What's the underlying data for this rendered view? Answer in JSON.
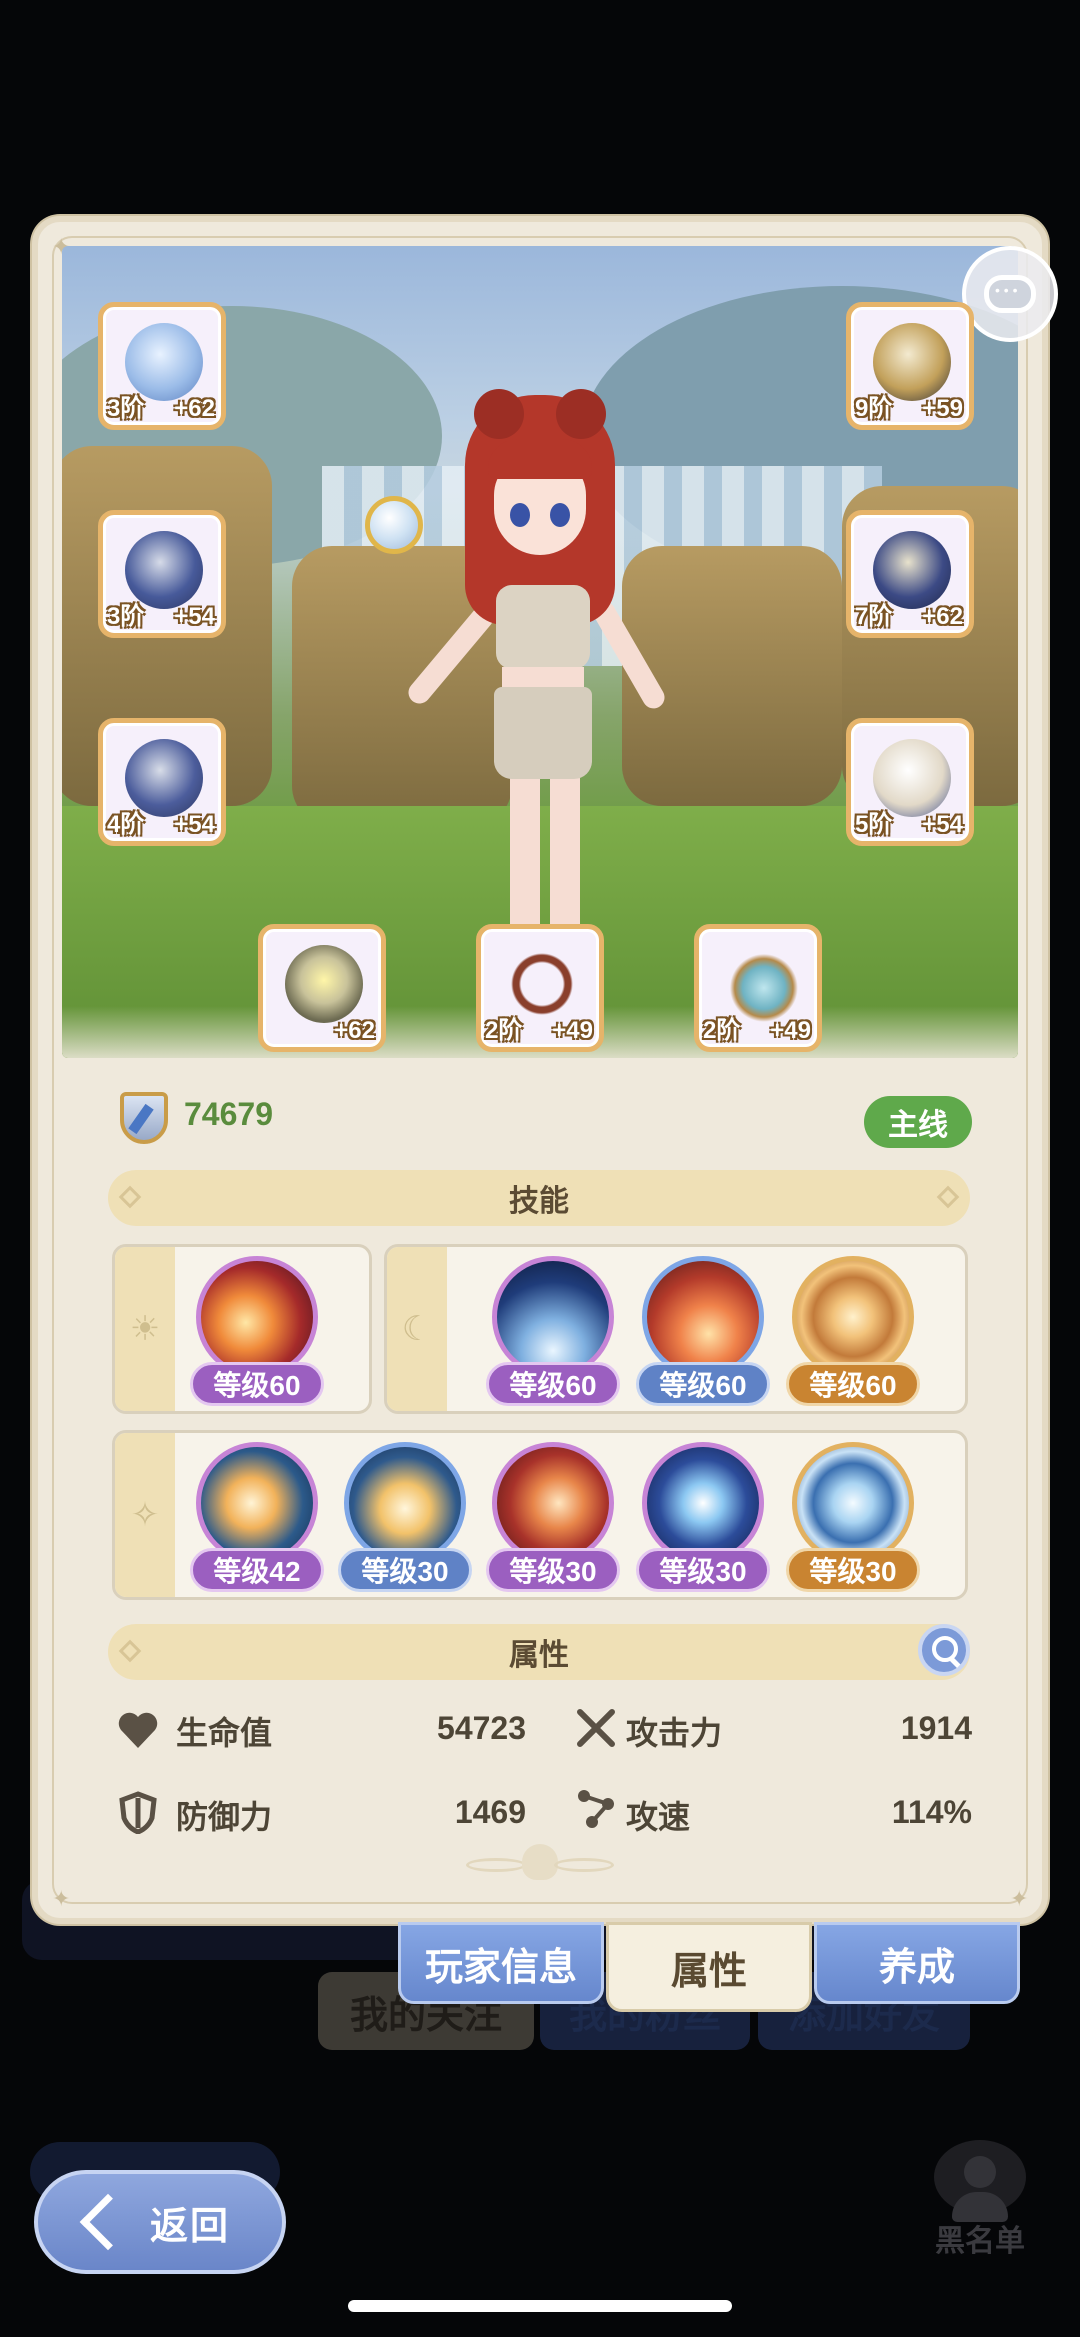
{
  "dialog": {
    "power_value": "74679",
    "main_badge": "主线",
    "skills_title": "技能",
    "attributes_title": "属性"
  },
  "equipment": [
    {
      "slot": "left-1",
      "tier": "3阶",
      "bonus": "+62",
      "icon": "crystal-weapon-icon"
    },
    {
      "slot": "left-2",
      "tier": "3阶",
      "bonus": "+54",
      "icon": "armor-chest-icon"
    },
    {
      "slot": "left-3",
      "tier": "4阶",
      "bonus": "+54",
      "icon": "leg-armor-icon"
    },
    {
      "slot": "right-1",
      "tier": "9阶",
      "bonus": "+59",
      "icon": "helmet-icon"
    },
    {
      "slot": "right-2",
      "tier": "7阶",
      "bonus": "+62",
      "icon": "gauntlet-icon"
    },
    {
      "slot": "right-3",
      "tier": "5阶",
      "bonus": "+54",
      "icon": "boots-icon"
    },
    {
      "slot": "bottom-1",
      "tier": "",
      "bonus": "+62",
      "icon": "ring-icon"
    },
    {
      "slot": "bottom-2",
      "tier": "2阶",
      "bonus": "+49",
      "icon": "necklace-icon"
    },
    {
      "slot": "bottom-3",
      "tier": "2阶",
      "bonus": "+49",
      "icon": "pendant-icon"
    }
  ],
  "skills": {
    "sun_row": [
      {
        "level": "等级60",
        "rarity": "purple",
        "icon": "fireball-skill-icon"
      }
    ],
    "moon_row": [
      {
        "level": "等级60",
        "rarity": "purple",
        "icon": "ice-burst-skill-icon"
      },
      {
        "level": "等级60",
        "rarity": "blue",
        "icon": "meteor-skill-icon"
      },
      {
        "level": "等级60",
        "rarity": "orange",
        "icon": "vortex-skill-icon"
      }
    ],
    "star_row": [
      {
        "level": "等级42",
        "rarity": "purple",
        "icon": "flame-wave-skill-icon"
      },
      {
        "level": "等级30",
        "rarity": "blue",
        "icon": "fire-spirit-skill-icon"
      },
      {
        "level": "等级30",
        "rarity": "purple",
        "icon": "fire-slash-skill-icon"
      },
      {
        "level": "等级30",
        "rarity": "purple",
        "icon": "frost-star-skill-icon"
      },
      {
        "level": "等级30",
        "rarity": "orange",
        "icon": "whirlwind-skill-icon"
      }
    ]
  },
  "attributes": {
    "hp_label": "生命值",
    "hp_value": "54723",
    "atk_label": "攻击力",
    "atk_value": "1914",
    "def_label": "防御力",
    "def_value": "1469",
    "spd_label": "攻速",
    "spd_value": "114%"
  },
  "tabs": {
    "player_info": "玩家信息",
    "attributes": "属性",
    "develop": "养成"
  },
  "background": {
    "my_follows": "我的关注",
    "my_fans": "我的粉丝",
    "add_friend": "添加好友",
    "back": "返回",
    "blacklist": "黑名单"
  }
}
